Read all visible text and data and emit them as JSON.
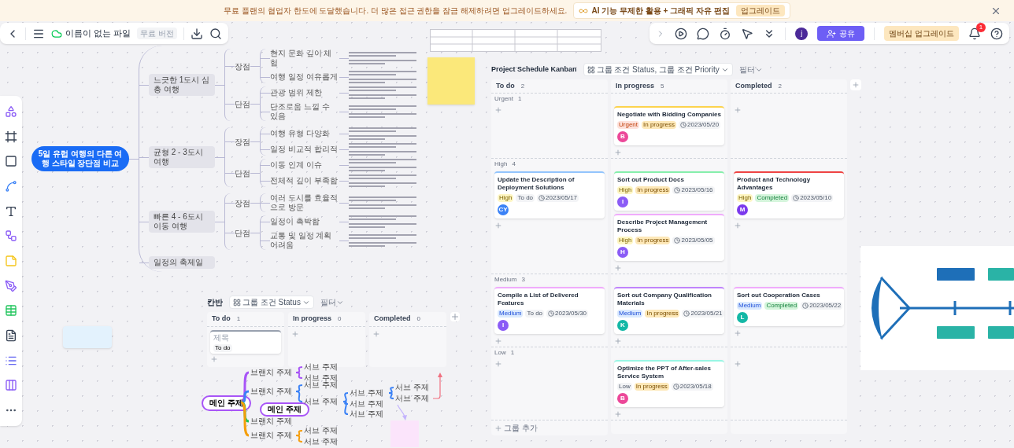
{
  "banner": {
    "message": "무료 플랜의 협업자 한도에 도달했습니다. 더 많은 접근 권한을 잠금 해제하려면 업그레이드하세요.",
    "promo": "AI 기능 무제한 활용 + 그래픽 자유 편집",
    "promo_button": "업그레이드"
  },
  "file_bar": {
    "file_name": "이름이 없는 파일",
    "badge": "무료 버전"
  },
  "action_bar": {
    "avatar": "j",
    "share": "공유",
    "upgrade": "멤버십 업그레이드",
    "notifications": "1"
  },
  "mindmap": {
    "root": "5일 유럽 여행의 다른 여행 스타일 장단점 비교",
    "branches": [
      {
        "label": "느긋한 1도시 심층 여행",
        "groups": [
          {
            "label": "장점",
            "items": [
              "현지 문화 깊이 체험",
              "여행 일정 여유롭게"
            ]
          },
          {
            "label": "단점",
            "items": [
              "관광 범위 제한",
              "단조로움 느낄 수 있음"
            ]
          }
        ]
      },
      {
        "label": "균형 2 - 3도시 여행",
        "groups": [
          {
            "label": "장점",
            "items": [
              "여행 유형 다양화",
              "일정 비교적 합리적"
            ]
          },
          {
            "label": "단점",
            "items": [
              "이동 인계 이슈",
              "전체적 깊이 부족함"
            ]
          }
        ]
      },
      {
        "label": "빠른 4 - 6도시 이동 여행",
        "groups": [
          {
            "label": "장점",
            "items": [
              "여러 도시를 효율적으로 방문"
            ]
          },
          {
            "label": "단점",
            "items": [
              "일정이 촉박함",
              "교통 및 일정 계획 어려움"
            ]
          }
        ]
      },
      {
        "label": "일정의 축제일"
      }
    ]
  },
  "small_kanban": {
    "title": "칸반",
    "group_by": "그룹 조건 Status",
    "filter": "필터",
    "columns": [
      {
        "label": "To do",
        "count": "1",
        "cards": [
          {
            "placeholder": "제목",
            "status": "To do"
          }
        ]
      },
      {
        "label": "In progress",
        "count": "0"
      },
      {
        "label": "Completed",
        "count": "0"
      }
    ]
  },
  "mindmap_2": {
    "root": "메인 주제",
    "floating_node": "메인 주제",
    "branches": [
      {
        "label": "브랜치 주제",
        "color": "#a855f7",
        "children": [
          {
            "label": "서브 주제"
          },
          {
            "label": "서브 주제"
          }
        ]
      },
      {
        "label": "브랜치 주제",
        "color": "#3b82f6",
        "children": [
          {
            "label": "서브 주제"
          },
          {
            "label": "서브 주제",
            "children": [
              {
                "label": "서브 주제",
                "children": [
                  {
                    "label": "서브 주제"
                  },
                  {
                    "label": "서브 주제"
                  }
                ]
              },
              {
                "label": "서브 주제"
              },
              {
                "label": "서브 주제"
              }
            ]
          }
        ]
      },
      {
        "label": "브랜치 주제",
        "color": "#22c55e"
      },
      {
        "label": "브랜치 주제",
        "color": "#f59e0b",
        "children": [
          {
            "label": "서브 주제"
          },
          {
            "label": "서브 주제"
          }
        ]
      }
    ]
  },
  "kanban": {
    "title": "Project Schedule Kanban",
    "group_by": "그룹 조건 Status, 그룹 조건 Priority",
    "filter": "필터",
    "columns": [
      {
        "label": "To do",
        "count": "2"
      },
      {
        "label": "In progress",
        "count": "5"
      },
      {
        "label": "Completed",
        "count": "2"
      }
    ],
    "lanes": [
      {
        "label": "Urgent",
        "count": "1",
        "cells": [
          {},
          {
            "cards": [
              {
                "title": "Negotiate with Bidding Companies",
                "priority": "Urgent",
                "status": "In progress",
                "date": "2023/05/20",
                "avatar": {
                  "initial": "B",
                  "color": "#ec4899"
                },
                "color": "#fcd34d"
              }
            ]
          },
          {}
        ]
      },
      {
        "label": "High",
        "count": "4",
        "cells": [
          {
            "cards": [
              {
                "title": "Update the Description of Deployment Solutions",
                "priority": "High",
                "status": "To do",
                "date": "2023/05/17",
                "avatar": {
                  "initial": "CY",
                  "color": "#3b82f6"
                },
                "color": "#93c5fd"
              }
            ]
          },
          {
            "cards": [
              {
                "title": "Sort out Product Docs",
                "priority": "High",
                "status": "In progress",
                "date": "2023/05/16",
                "avatar": {
                  "initial": "I",
                  "color": "#8b5cf6"
                },
                "color": "#86efac"
              },
              {
                "title": "Describe Project Management Process",
                "priority": "High",
                "status": "In progress",
                "date": "2023/05/05",
                "avatar": {
                  "initial": "H",
                  "color": "#8b5cf6"
                },
                "color": "#f0abfc"
              }
            ]
          },
          {
            "cards": [
              {
                "title": "Product and Technology Advantages",
                "priority": "High",
                "status": "Completed",
                "date": "2023/05/10",
                "avatar": {
                  "initial": "M",
                  "color": "#7c3aed"
                },
                "color": "#ef4444"
              }
            ]
          }
        ]
      },
      {
        "label": "Medium",
        "count": "3",
        "cells": [
          {
            "cards": [
              {
                "title": "Compile a List of Delivered Features",
                "priority": "Medium",
                "status": "To do",
                "date": "2023/05/30",
                "avatar": {
                  "initial": "I",
                  "color": "#8b5cf6"
                },
                "color": "#f0abfc"
              }
            ]
          },
          {
            "cards": [
              {
                "title": "Sort out Company Qualification Materials",
                "priority": "Medium",
                "status": "In progress",
                "date": "2023/05/21",
                "avatar": {
                  "initial": "K",
                  "color": "#14b8a6"
                },
                "color": "#c084fc"
              }
            ]
          },
          {
            "cards": [
              {
                "title": "Sort out Cooperation Cases",
                "priority": "Medium",
                "status": "Completed",
                "date": "2023/05/22",
                "avatar": {
                  "initial": "L",
                  "color": "#14b8a6"
                },
                "color": "#f0abfc"
              }
            ]
          }
        ]
      },
      {
        "label": "Low",
        "count": "1",
        "cells": [
          {},
          {
            "cards": [
              {
                "title": "Optimize the PPT of After-sales Service System",
                "priority": "Low",
                "status": "In progress",
                "date": "2023/05/18",
                "avatar": {
                  "initial": "B",
                  "color": "#ec4899"
                },
                "color": "#99f6e4"
              }
            ]
          },
          {}
        ]
      }
    ],
    "add_group": "그룹 추가"
  }
}
